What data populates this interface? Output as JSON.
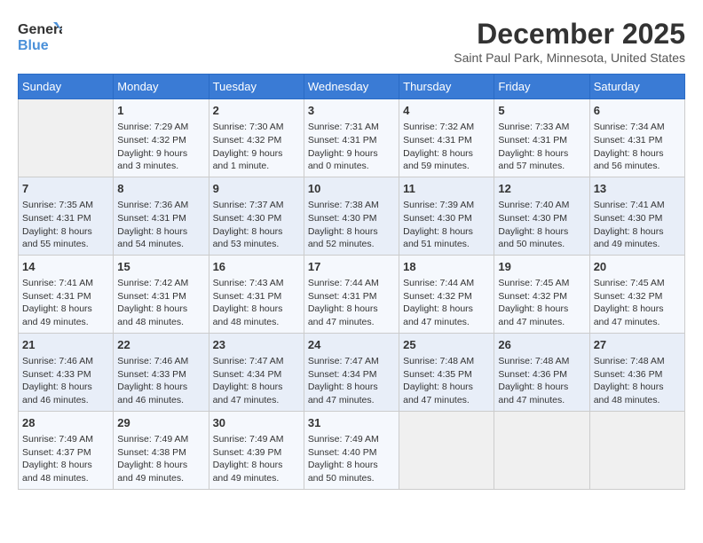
{
  "logo": {
    "line1": "General",
    "line2": "Blue"
  },
  "title": "December 2025",
  "subtitle": "Saint Paul Park, Minnesota, United States",
  "weekdays": [
    "Sunday",
    "Monday",
    "Tuesday",
    "Wednesday",
    "Thursday",
    "Friday",
    "Saturday"
  ],
  "weeks": [
    [
      {
        "day": "",
        "info": ""
      },
      {
        "day": "1",
        "info": "Sunrise: 7:29 AM\nSunset: 4:32 PM\nDaylight: 9 hours\nand 3 minutes."
      },
      {
        "day": "2",
        "info": "Sunrise: 7:30 AM\nSunset: 4:32 PM\nDaylight: 9 hours\nand 1 minute."
      },
      {
        "day": "3",
        "info": "Sunrise: 7:31 AM\nSunset: 4:31 PM\nDaylight: 9 hours\nand 0 minutes."
      },
      {
        "day": "4",
        "info": "Sunrise: 7:32 AM\nSunset: 4:31 PM\nDaylight: 8 hours\nand 59 minutes."
      },
      {
        "day": "5",
        "info": "Sunrise: 7:33 AM\nSunset: 4:31 PM\nDaylight: 8 hours\nand 57 minutes."
      },
      {
        "day": "6",
        "info": "Sunrise: 7:34 AM\nSunset: 4:31 PM\nDaylight: 8 hours\nand 56 minutes."
      }
    ],
    [
      {
        "day": "7",
        "info": "Sunrise: 7:35 AM\nSunset: 4:31 PM\nDaylight: 8 hours\nand 55 minutes."
      },
      {
        "day": "8",
        "info": "Sunrise: 7:36 AM\nSunset: 4:31 PM\nDaylight: 8 hours\nand 54 minutes."
      },
      {
        "day": "9",
        "info": "Sunrise: 7:37 AM\nSunset: 4:30 PM\nDaylight: 8 hours\nand 53 minutes."
      },
      {
        "day": "10",
        "info": "Sunrise: 7:38 AM\nSunset: 4:30 PM\nDaylight: 8 hours\nand 52 minutes."
      },
      {
        "day": "11",
        "info": "Sunrise: 7:39 AM\nSunset: 4:30 PM\nDaylight: 8 hours\nand 51 minutes."
      },
      {
        "day": "12",
        "info": "Sunrise: 7:40 AM\nSunset: 4:30 PM\nDaylight: 8 hours\nand 50 minutes."
      },
      {
        "day": "13",
        "info": "Sunrise: 7:41 AM\nSunset: 4:30 PM\nDaylight: 8 hours\nand 49 minutes."
      }
    ],
    [
      {
        "day": "14",
        "info": "Sunrise: 7:41 AM\nSunset: 4:31 PM\nDaylight: 8 hours\nand 49 minutes."
      },
      {
        "day": "15",
        "info": "Sunrise: 7:42 AM\nSunset: 4:31 PM\nDaylight: 8 hours\nand 48 minutes."
      },
      {
        "day": "16",
        "info": "Sunrise: 7:43 AM\nSunset: 4:31 PM\nDaylight: 8 hours\nand 48 minutes."
      },
      {
        "day": "17",
        "info": "Sunrise: 7:44 AM\nSunset: 4:31 PM\nDaylight: 8 hours\nand 47 minutes."
      },
      {
        "day": "18",
        "info": "Sunrise: 7:44 AM\nSunset: 4:32 PM\nDaylight: 8 hours\nand 47 minutes."
      },
      {
        "day": "19",
        "info": "Sunrise: 7:45 AM\nSunset: 4:32 PM\nDaylight: 8 hours\nand 47 minutes."
      },
      {
        "day": "20",
        "info": "Sunrise: 7:45 AM\nSunset: 4:32 PM\nDaylight: 8 hours\nand 47 minutes."
      }
    ],
    [
      {
        "day": "21",
        "info": "Sunrise: 7:46 AM\nSunset: 4:33 PM\nDaylight: 8 hours\nand 46 minutes."
      },
      {
        "day": "22",
        "info": "Sunrise: 7:46 AM\nSunset: 4:33 PM\nDaylight: 8 hours\nand 46 minutes."
      },
      {
        "day": "23",
        "info": "Sunrise: 7:47 AM\nSunset: 4:34 PM\nDaylight: 8 hours\nand 47 minutes."
      },
      {
        "day": "24",
        "info": "Sunrise: 7:47 AM\nSunset: 4:34 PM\nDaylight: 8 hours\nand 47 minutes."
      },
      {
        "day": "25",
        "info": "Sunrise: 7:48 AM\nSunset: 4:35 PM\nDaylight: 8 hours\nand 47 minutes."
      },
      {
        "day": "26",
        "info": "Sunrise: 7:48 AM\nSunset: 4:36 PM\nDaylight: 8 hours\nand 47 minutes."
      },
      {
        "day": "27",
        "info": "Sunrise: 7:48 AM\nSunset: 4:36 PM\nDaylight: 8 hours\nand 48 minutes."
      }
    ],
    [
      {
        "day": "28",
        "info": "Sunrise: 7:49 AM\nSunset: 4:37 PM\nDaylight: 8 hours\nand 48 minutes."
      },
      {
        "day": "29",
        "info": "Sunrise: 7:49 AM\nSunset: 4:38 PM\nDaylight: 8 hours\nand 49 minutes."
      },
      {
        "day": "30",
        "info": "Sunrise: 7:49 AM\nSunset: 4:39 PM\nDaylight: 8 hours\nand 49 minutes."
      },
      {
        "day": "31",
        "info": "Sunrise: 7:49 AM\nSunset: 4:40 PM\nDaylight: 8 hours\nand 50 minutes."
      },
      {
        "day": "",
        "info": ""
      },
      {
        "day": "",
        "info": ""
      },
      {
        "day": "",
        "info": ""
      }
    ]
  ]
}
